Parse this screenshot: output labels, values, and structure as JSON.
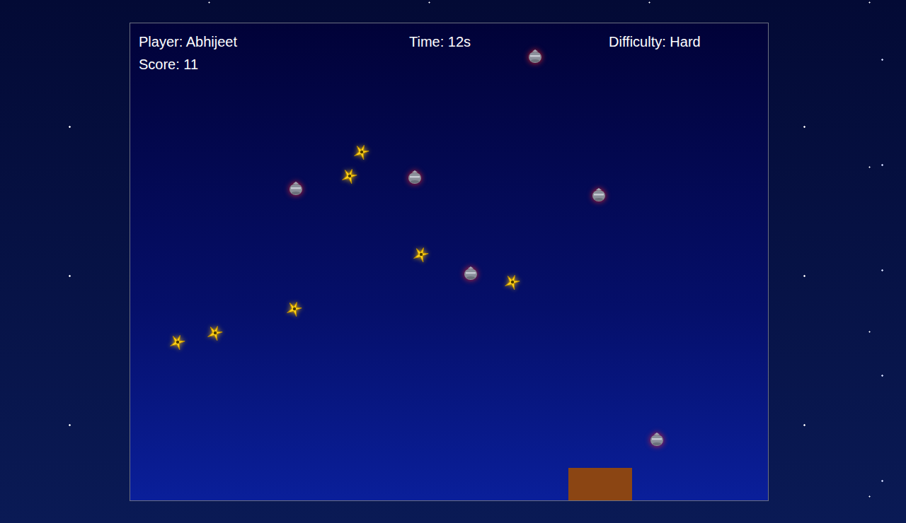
{
  "hud": {
    "player": "Player: Abhijeet",
    "time": "Time: 12s",
    "difficulty": "Difficulty: Hard",
    "score": "Score: 11"
  },
  "items": [
    {
      "kind": "bomb"
    },
    {
      "kind": "star"
    },
    {
      "kind": "star"
    },
    {
      "kind": "bomb"
    },
    {
      "kind": "bomb"
    },
    {
      "kind": "bomb"
    },
    {
      "kind": "star"
    },
    {
      "kind": "bomb"
    },
    {
      "kind": "star"
    },
    {
      "kind": "star"
    },
    {
      "kind": "star"
    },
    {
      "kind": "star"
    },
    {
      "kind": "bomb"
    }
  ]
}
